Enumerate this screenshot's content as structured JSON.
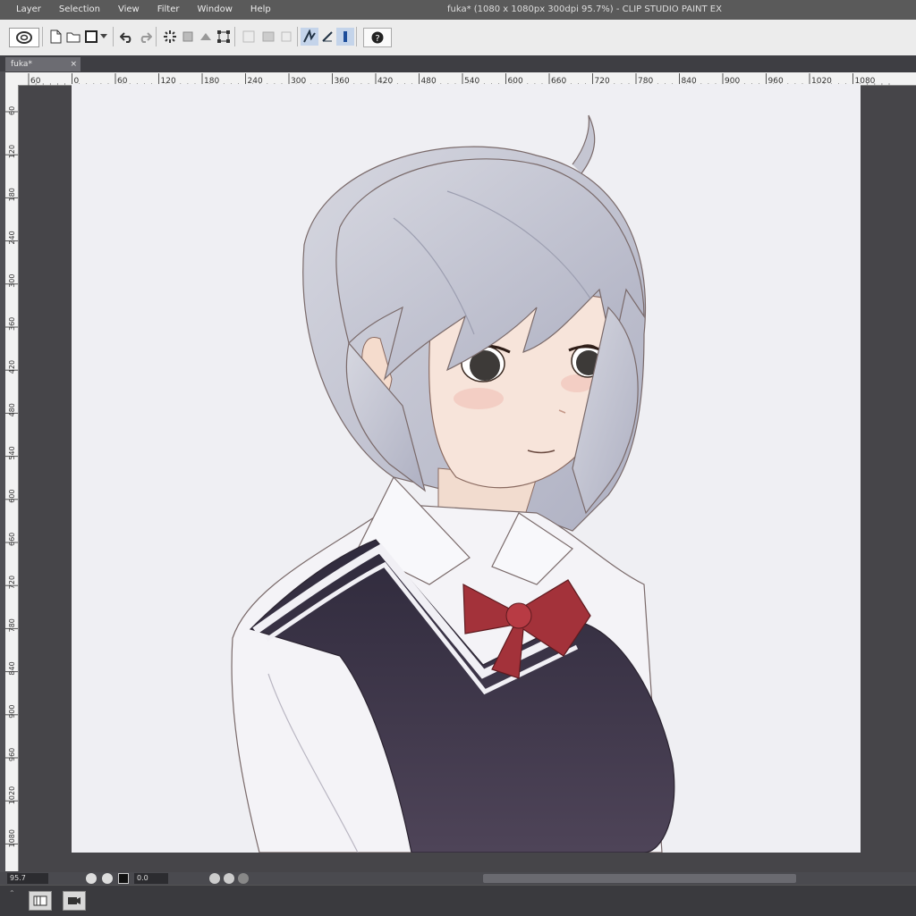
{
  "window": {
    "title": "fuka* (1080 x 1080px 300dpi 95.7%)  - CLIP STUDIO PAINT EX"
  },
  "menu": {
    "items": [
      "Layer",
      "Selection",
      "View",
      "Filter",
      "Window",
      "Help"
    ]
  },
  "toolbar": {
    "icons": [
      "clip-studio-logo-icon",
      "new-file-icon",
      "open-file-icon",
      "save-icon",
      "undo-icon",
      "redo-icon",
      "clear-icon",
      "fill-icon",
      "transform-icon",
      "free-transform-icon",
      "snap-icon",
      "ruler-snap-icon",
      "special-ruler-icon",
      "help-icon"
    ]
  },
  "tab": {
    "label": "fuka*",
    "close": "×"
  },
  "ruler": {
    "h_labels": [
      "60",
      "0",
      "60",
      "120",
      "180",
      "240",
      "300",
      "360",
      "420",
      "480",
      "540",
      "600",
      "660",
      "720",
      "780",
      "840",
      "900",
      "960",
      "1020",
      "1080"
    ],
    "v_labels": [
      "60",
      "120",
      "180",
      "240",
      "300",
      "360",
      "420",
      "480",
      "540",
      "600",
      "660",
      "720",
      "780",
      "840",
      "900",
      "960",
      "1020",
      "1080"
    ]
  },
  "status": {
    "zoom": "95.7",
    "rotation": "0.0"
  },
  "colors": {
    "hair": "#c5c6d2",
    "skin": "#f7e4da",
    "vest": "#3c3347",
    "bow": "#a3323a",
    "shirt": "#f4f3f7",
    "eye": "#3d3a38"
  }
}
